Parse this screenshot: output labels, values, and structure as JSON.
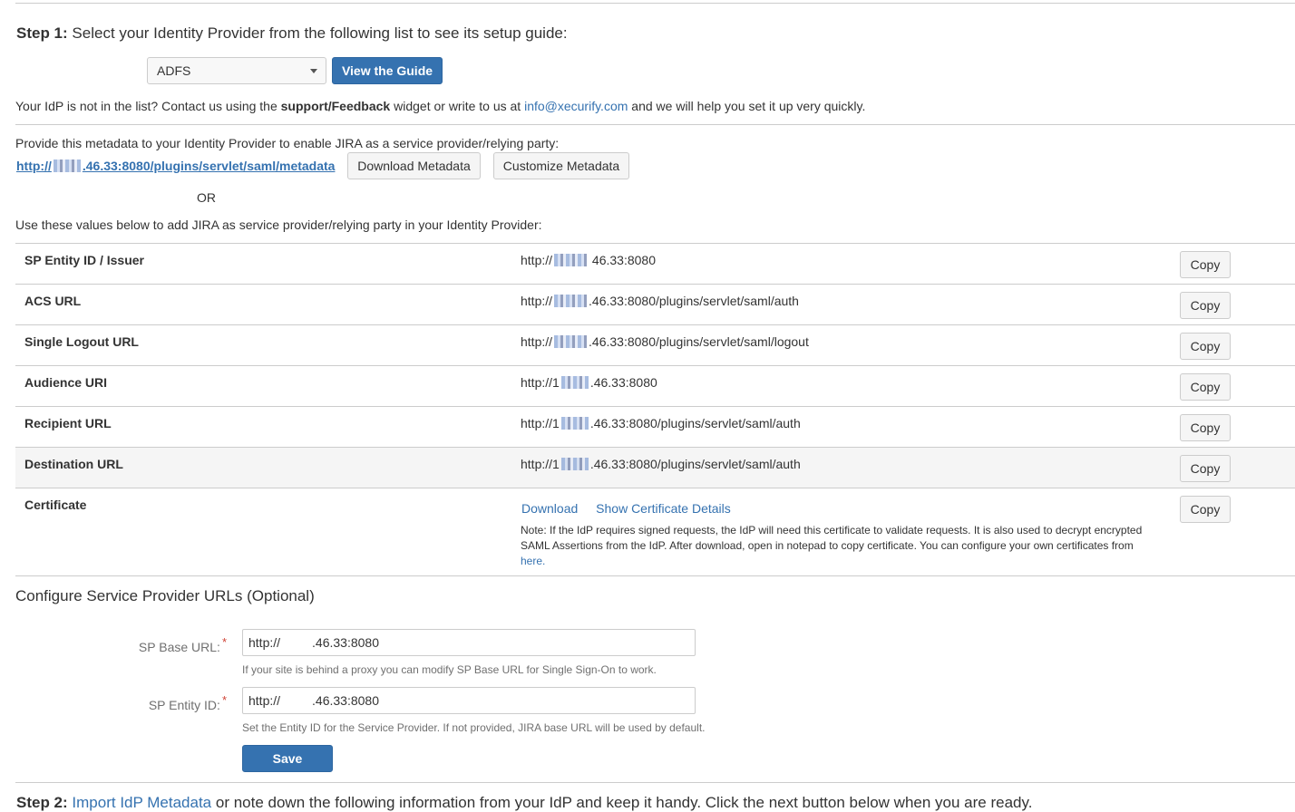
{
  "step1": {
    "prefix": "Step 1:",
    "text": "Select your Identity Provider from the following list to see its setup guide:",
    "idp_selected": "ADFS",
    "view_guide_label": "View the Guide"
  },
  "notlisted": {
    "pre": "Your IdP is not in the list? Contact us using the",
    "widget": "support/Feedback",
    "mid": "widget or write to us at",
    "email": "info@xecurify.com",
    "post": "and we will help you set it up very quickly."
  },
  "metadata": {
    "intro": "Provide this metadata to your Identity Provider to enable JIRA as a service provider/relying party:",
    "url_prefix": "http://",
    "url_suffix": ".46.33:8080/plugins/servlet/saml/metadata",
    "download_label": "Download Metadata",
    "customize_label": "Customize Metadata",
    "or_text": "OR",
    "values_intro": "Use these values below to add JIRA as service provider/relying party in your Identity Provider:"
  },
  "sp_table": {
    "copy_label": "Copy",
    "rows": [
      {
        "label": "SP Entity ID / Issuer",
        "prefix": "http://",
        "suffix": " 46.33:8080"
      },
      {
        "label": "ACS URL",
        "prefix": "http://",
        "suffix": ".46.33:8080/plugins/servlet/saml/auth"
      },
      {
        "label": "Single Logout URL",
        "prefix": "http://",
        "suffix": ".46.33:8080/plugins/servlet/saml/logout"
      },
      {
        "label": "Audience URI",
        "prefix": "http://1",
        "suffix": ".46.33:8080"
      },
      {
        "label": "Recipient URL",
        "prefix": "http://1",
        "suffix": ".46.33:8080/plugins/servlet/saml/auth"
      },
      {
        "label": "Destination URL",
        "prefix": "http://1",
        "suffix": ".46.33:8080/plugins/servlet/saml/auth"
      }
    ],
    "certificate": {
      "label": "Certificate",
      "download": "Download",
      "show_details": "Show Certificate Details",
      "note": "Note: If the IdP requires signed requests, the IdP will need this certificate to validate requests. It is also used to decrypt encrypted SAML Assertions from the IdP. After download, open in notepad to copy certificate. You can configure your own certificates from",
      "here": "here."
    }
  },
  "configure": {
    "title": "Configure Service Provider URLs (Optional)",
    "base_url_label": "SP Base URL:",
    "base_url_value": "http://         .46.33:8080",
    "base_url_help": "If your site is behind a proxy you can modify SP Base URL for Single Sign-On to work.",
    "entity_id_label": "SP Entity ID:",
    "entity_id_value": "http://         .46.33:8080",
    "entity_id_help": "Set the Entity ID for the Service Provider. If not provided, JIRA base URL will be used by default.",
    "save_label": "Save",
    "required_mark": "*"
  },
  "step2": {
    "prefix": "Step 2:",
    "link": "Import IdP Metadata",
    "text": "or note down the following information from your IdP and keep it handy. Click the next button below when you are ready."
  },
  "colors": {
    "primary": "#3572b0",
    "link": "#3572b0",
    "border": "#cccccc",
    "required": "#d04437",
    "row_highlight": "#f5f5f5"
  }
}
